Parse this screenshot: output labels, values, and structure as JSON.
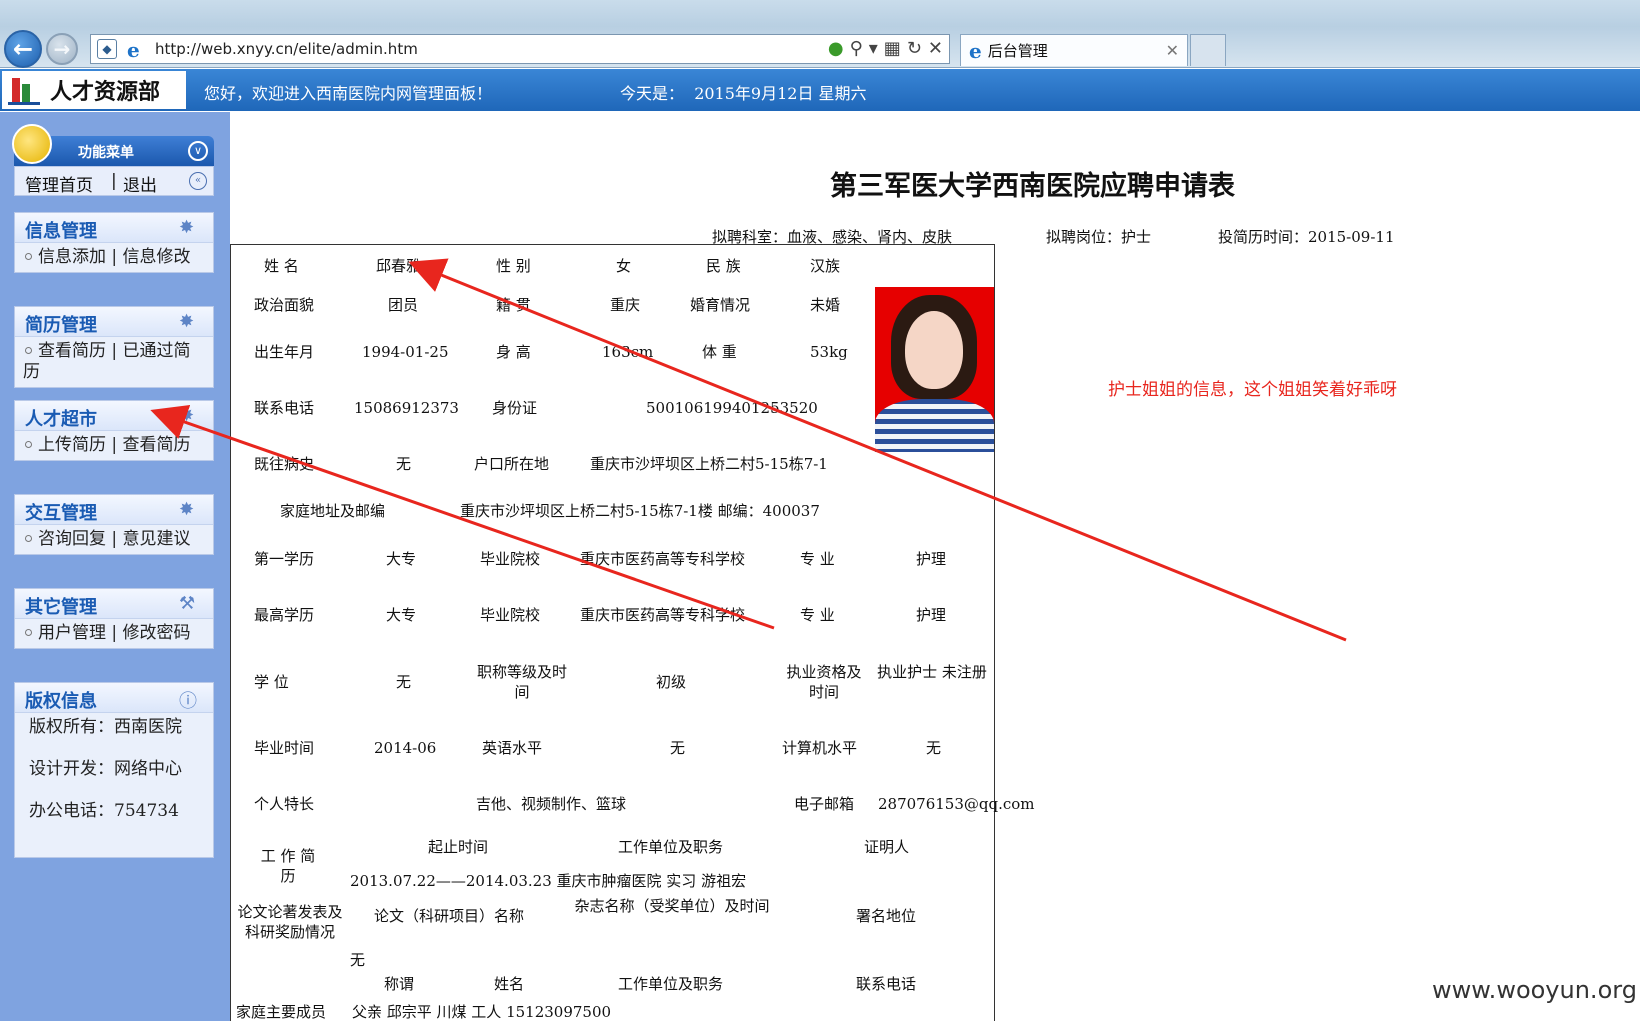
{
  "browser": {
    "url": "http://web.xnyy.cn/elite/admin.htm",
    "tab_title": "后台管理"
  },
  "header": {
    "logo_text": "人才资源部",
    "welcome": "您好，欢迎进入西南医院内网管理面板！",
    "today_label": "今天是：",
    "today_value": "2015年9月12日  星期六"
  },
  "sidebar": {
    "menu_title": "功能菜单",
    "home": "管理首页",
    "logout": "退出",
    "sections": [
      {
        "title": "信息管理",
        "items": "信息添加 | 信息修改"
      },
      {
        "title": "简历管理",
        "items": "查看简历 | 已通过简历"
      },
      {
        "title": "人才超市",
        "items": "上传简历 | 查看简历"
      },
      {
        "title": "交互管理",
        "items": "咨询回复 | 意见建议"
      },
      {
        "title": "其它管理",
        "items": "用户管理 | 修改密码"
      }
    ],
    "copyright": {
      "title": "版权信息",
      "owner": "版权所有：西南医院",
      "developer": "设计开发：网络中心",
      "phone": "办公电话：754734"
    }
  },
  "doc": {
    "title": "第三军医大学西南医院应聘申请表",
    "dept": "拟聘科室：血液、感染、肾内、皮肤",
    "post": "拟聘岗位：护士",
    "date": "投简历时间：2015-09-11",
    "rows": {
      "name_l": "姓 名",
      "name_v": "邱春雅",
      "gender_l": "性 别",
      "gender_v": "女",
      "ethnic_l": "民 族",
      "ethnic_v": "汉族",
      "politic_l": "政治面貌",
      "politic_v": "团员",
      "origin_l": "籍 贯",
      "origin_v": "重庆",
      "marital_l": "婚育情况",
      "marital_v": "未婚",
      "birth_l": "出生年月",
      "birth_v": "1994-01-25",
      "height_l": "身 高",
      "height_v": "163cm",
      "weight_l": "体 重",
      "weight_v": "53kg",
      "phone_l": "联系电话",
      "phone_v": "15086912373",
      "id_l": "身份证",
      "id_v": "500106199401253520",
      "history_l": "既往病史",
      "history_v": "无",
      "hukou_l": "户口所在地",
      "hukou_v": "重庆市沙坪坝区上桥二村5-15栋7-1",
      "addr_l": "家庭地址及邮编",
      "addr_v": "重庆市沙坪坝区上桥二村5-15栋7-1楼 邮编：400037",
      "edu1_l": "第一学历",
      "edu1_v": "大专",
      "school1_l": "毕业院校",
      "school1_v": "重庆市医药高等专科学校",
      "major1_l": "专 业",
      "major1_v": "护理",
      "edu2_l": "最高学历",
      "edu2_v": "大专",
      "school2_l": "毕业院校",
      "school2_v": "重庆市医药高等专科学校",
      "major2_l": "专 业",
      "major2_v": "护理",
      "degree_l": "学 位",
      "degree_v": "无",
      "title_l": "职称等级及时间",
      "title_v": "初级",
      "cert_l": "执业资格及时间",
      "cert_v": "执业护士 未注册",
      "grad_l": "毕业时间",
      "grad_v": "2014-06",
      "eng_l": "英语水平",
      "eng_v": "无",
      "comp_l": "计算机水平",
      "comp_v": "无",
      "skill_l": "个人特长",
      "skill_v": "吉他、视频制作、篮球",
      "email_l": "电子邮箱",
      "email_v": "287076153@qq.com",
      "work_l": "工 作 简 历",
      "work_h1": "起止时间",
      "work_h2": "工作单位及职务",
      "work_h3": "证明人",
      "work_v": "2013.07.22——2014.03.23 重庆市肿瘤医院 实习 游祖宏",
      "paper_l": "论文论著发表及科研奖励情况",
      "paper_h1": "论文（科研项目）名称",
      "paper_h2": "杂志名称（受奖单位）及时间",
      "paper_h3": "署名地位",
      "paper_v": "无",
      "fam_h1": "称谓",
      "fam_h2": "姓名",
      "fam_h3": "工作单位及职务",
      "fam_h4": "联系电话",
      "fam_l": "家庭主要成员",
      "fam_v": "父亲 邱宗平 川煤 工人 15123097500"
    }
  },
  "annotation": "护士姐姐的信息，这个姐姐笑着好乖呀",
  "watermark": "www.wooyun.org",
  "colors": {
    "header_blue": "#1f67b9",
    "sidebar_bg": "#7fa3e0",
    "annotation_red": "#e8261e"
  }
}
